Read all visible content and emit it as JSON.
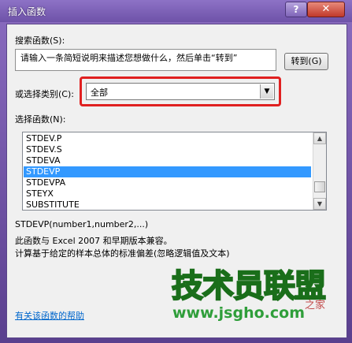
{
  "window": {
    "title": "插入函数",
    "help_glyph": "?",
    "close_glyph": "✕"
  },
  "search": {
    "label": "搜索函数(S):",
    "text": "请输入一条简短说明来描述您想做什么，然后单击“转到”",
    "go_label": "转到(G)"
  },
  "category": {
    "label": "或选择类别(C):",
    "selected": "全部",
    "arrow": "▼"
  },
  "functions": {
    "label": "选择函数(N):",
    "items": [
      "STDEV.P",
      "STDEV.S",
      "STDEVA",
      "STDEVP",
      "STDEVPA",
      "STEYX",
      "SUBSTITUTE"
    ],
    "selected_index": 3,
    "scroll_up": "▲",
    "scroll_down": "▼"
  },
  "description": {
    "signature": "STDEVP(number1,number2,...)",
    "line1": "此函数与 Excel 2007 和早期版本兼容。",
    "line2": "计算基于给定的样本总体的标准偏差(忽略逻辑值及文本)"
  },
  "help_link": "有关该函数的帮助",
  "watermark": {
    "main": "技术员联盟",
    "url": "www.jsgho.com",
    "side": "之家"
  }
}
